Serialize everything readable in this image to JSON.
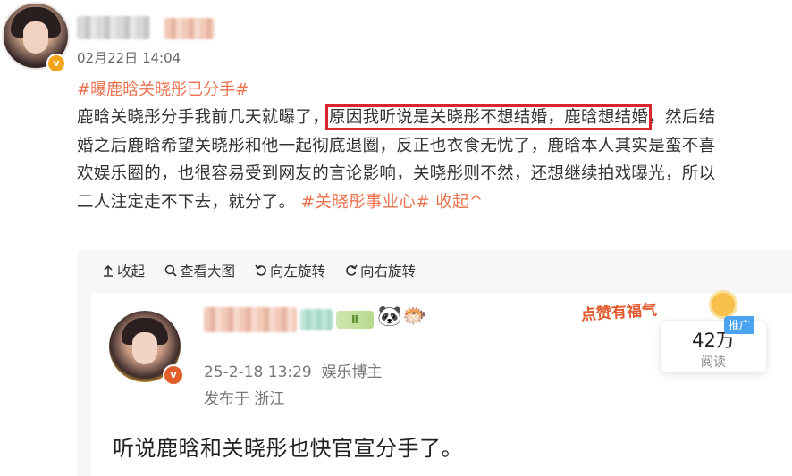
{
  "post": {
    "time": "02月22日 14:04",
    "topic": "#曝鹿晗关晓彤已分手#",
    "lines": [
      {
        "pre": "鹿晗关晓彤分手我前几天就曝了，",
        "hl": "原因我听说是关晓彤不想结婚，鹿晗想结婚",
        "post": "，然后结"
      },
      {
        "text": "婚之后鹿晗希望关晓彤和他一起彻底退圈，反正也衣食无忧了，鹿晗本人其实是蛮不喜"
      },
      {
        "text": "欢娱乐圈的，也很容易受到网友的言论影响，关晓彤则不然，还想继续拍戏曝光，所以"
      },
      {
        "text": "二人注定走不下去，就分了。"
      }
    ],
    "tag2": "#关晓彤事业心#",
    "collapse": "收起^"
  },
  "toolbar": {
    "collapse": "收起",
    "view_large": "查看大图",
    "rotate_left": "向左旋转",
    "rotate_right": "向右旋转"
  },
  "inner_post": {
    "level_badge": "Ⅱ",
    "date_line": "25-2-18 13:29  娱乐博主",
    "location_line": "发布于 浙江",
    "text": "听说鹿晗和关晓彤也快官宣分手了。",
    "reads_num": "42万",
    "reads_label": "阅读",
    "promo": "推广",
    "likes_sticker": "点赞有福气"
  },
  "colors": {
    "link": "#eb7350",
    "highlight_border": "#d9252e",
    "verified_badge": "#f3a51a"
  }
}
